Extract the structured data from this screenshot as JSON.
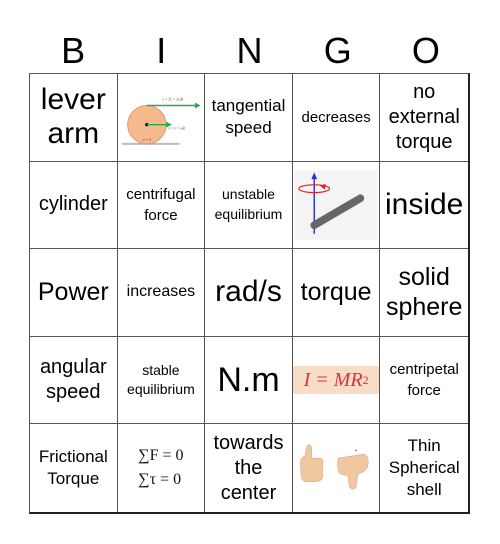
{
  "header": {
    "letters": [
      "B",
      "I",
      "N",
      "G",
      "O"
    ]
  },
  "cells": [
    {
      "text": "lever arm"
    },
    {
      "image": "rolling-disk-velocity-diagram",
      "caption": ""
    },
    {
      "text": "tangential speed"
    },
    {
      "text": "decreases"
    },
    {
      "text": "no external torque"
    },
    {
      "text": "cylinder"
    },
    {
      "text": "centrifugal force"
    },
    {
      "text": "unstable equilibrium"
    },
    {
      "image": "rotating-rod-diagram"
    },
    {
      "text": "inside"
    },
    {
      "text": "Power"
    },
    {
      "text": "increases"
    },
    {
      "text": "rad/s"
    },
    {
      "text": "torque"
    },
    {
      "text": "solid sphere"
    },
    {
      "text": "angular speed"
    },
    {
      "text": "stable equilibrium"
    },
    {
      "text": "N.m"
    },
    {
      "formula": {
        "lhs": "I = MR",
        "exp": "2"
      }
    },
    {
      "text": "centripetal force"
    },
    {
      "text": "Frictional Torque"
    },
    {
      "formula_lines": [
        "∑F = 0",
        "∑τ = 0"
      ]
    },
    {
      "text": "towards the center"
    },
    {
      "image": "thumbs-up-thumbs-down"
    },
    {
      "text": "Thin Spherical shell"
    }
  ],
  "colors": {
    "green_arrow": "#2aa84a",
    "disk": "#f6b98e",
    "axis_blue": "#2430e0",
    "rotation_red": "#e02020",
    "inertia_text": "#e0304a",
    "inertia_bg": "#f7dcc6"
  }
}
